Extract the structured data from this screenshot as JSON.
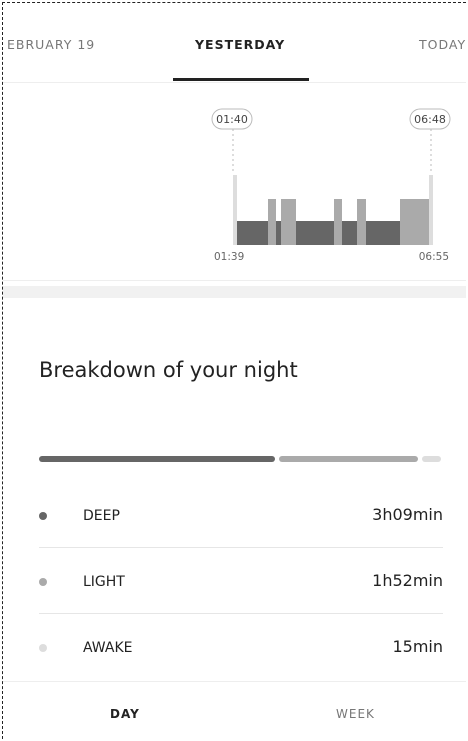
{
  "tabs": [
    {
      "label": "EBRUARY 19"
    },
    {
      "label": "YESTERDAY"
    },
    {
      "label": "TODAY"
    }
  ],
  "chart": {
    "bubble_start": "01:40",
    "bubble_end": "06:48",
    "axis_start": "01:39",
    "axis_end": "06:55"
  },
  "breakdown": {
    "title": "Breakdown of your night",
    "rows": [
      {
        "label": "DEEP",
        "value": "3h09min",
        "color": "#666666"
      },
      {
        "label": "LIGHT",
        "value": "1h52min",
        "color": "#aaaaaa"
      },
      {
        "label": "AWAKE",
        "value": "15min",
        "color": "#dddddd"
      }
    ],
    "proportions": {
      "deep": 189,
      "light": 112,
      "awake": 15
    }
  },
  "bottom_nav": [
    {
      "label": "DAY"
    },
    {
      "label": "WEEK"
    }
  ]
}
